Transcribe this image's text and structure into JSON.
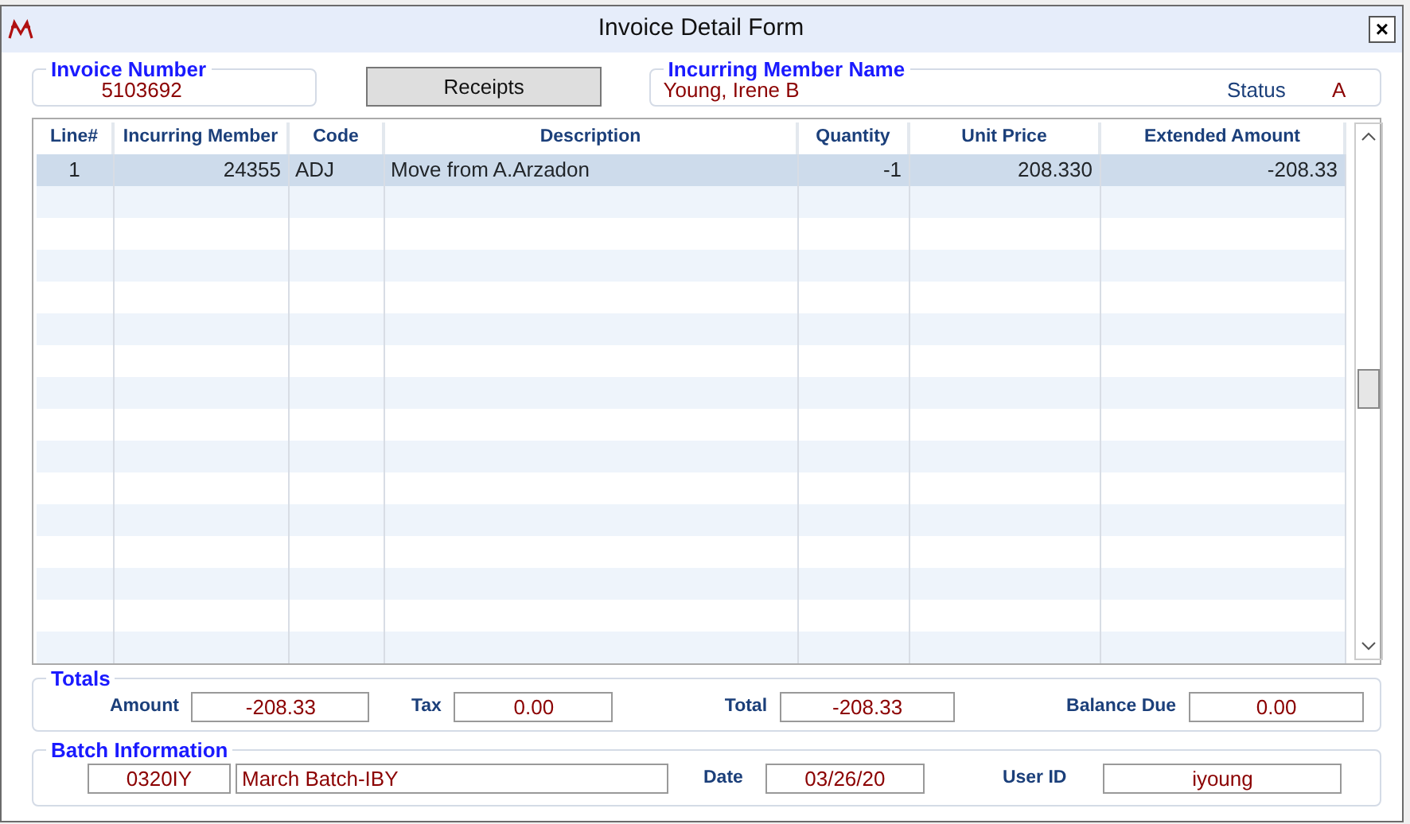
{
  "window": {
    "title": "Invoice Detail Form",
    "close": "×"
  },
  "invoice": {
    "label": "Invoice Number",
    "value": "5103692"
  },
  "receipts_button": "Receipts",
  "member": {
    "label": "Incurring Member Name",
    "value": "Young, Irene B",
    "status_label": "Status",
    "status_value": "A"
  },
  "table": {
    "columns": [
      "Line#",
      "Incurring Member",
      "Code",
      "Description",
      "Quantity",
      "Unit Price",
      "Extended Amount"
    ],
    "rows": [
      {
        "cells": [
          "1",
          "24355",
          "ADJ",
          "Move from A.Arzadon",
          "-1",
          "208.330",
          "-208.33"
        ],
        "selected": true
      }
    ]
  },
  "totals": {
    "title": "Totals",
    "fields": [
      {
        "label": "Amount",
        "value": "-208.33"
      },
      {
        "label": "Tax",
        "value": "0.00"
      },
      {
        "label": "Total",
        "value": "-208.33"
      },
      {
        "label": "Balance Due",
        "value": "0.00"
      }
    ]
  },
  "batch": {
    "title": "Batch Information",
    "batch_id": "0320IY",
    "batch_name": "March Batch-IBY",
    "date_label": "Date",
    "date": "03/26/20",
    "user_label": "User ID",
    "user": "iyoung"
  }
}
